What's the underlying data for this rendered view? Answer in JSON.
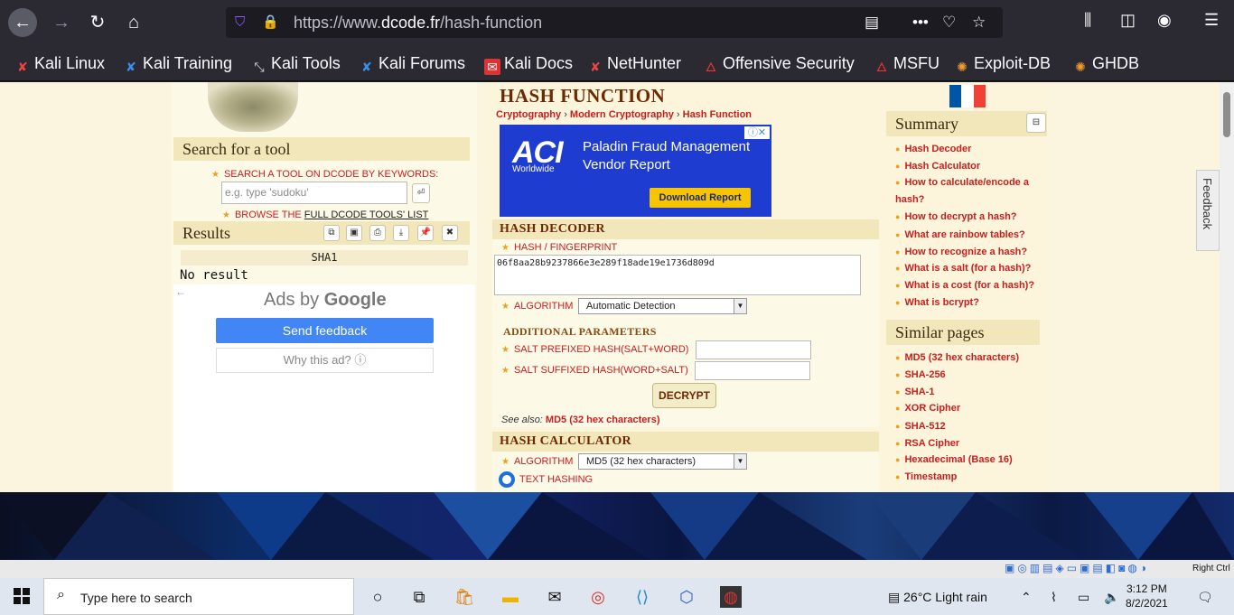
{
  "browser": {
    "url_prefix": "https://www.",
    "url_domain": "dcode.fr",
    "url_path": "/hash-function",
    "icons": [
      "back-icon",
      "forward-icon",
      "reload-icon",
      "home-icon",
      "tracking-shield-icon",
      "lock-icon",
      "reader-view-icon",
      "page-actions-icon",
      "pocket-icon",
      "bookmark-star-icon",
      "library-icon",
      "sidebar-icon",
      "account-icon",
      "menu-icon"
    ]
  },
  "bookmarks": [
    {
      "label": "Kali Linux"
    },
    {
      "label": "Kali Training"
    },
    {
      "label": "Kali Tools"
    },
    {
      "label": "Kali Forums"
    },
    {
      "label": "Kali Docs"
    },
    {
      "label": "NetHunter"
    },
    {
      "label": "Offensive Security"
    },
    {
      "label": "MSFU"
    },
    {
      "label": "Exploit-DB"
    },
    {
      "label": "GHDB"
    }
  ],
  "left": {
    "search_head": "Search for a tool",
    "search_hint": "SEARCH A TOOL ON DCODE BY KEYWORDS:",
    "search_placeholder": "e.g. type 'sudoku'",
    "browse_prefix": "BROWSE THE ",
    "browse_link": "FULL DCODE TOOLS' LIST",
    "results_head": "Results",
    "sha_label": "SHA1",
    "no_result": "No result",
    "ads_by": "Ads by ",
    "ads_google": "Google",
    "send_feedback": "Send feedback",
    "why_ad": "Why this ad? ⓘ"
  },
  "main": {
    "title": "HASH FUNCTION",
    "crumbs": [
      "Cryptography",
      "Modern Cryptography",
      "Hash Function"
    ],
    "ad": {
      "logo": "ACI",
      "logo_sub": "Worldwide",
      "line1": "Paladin Fraud Management",
      "line2": "Vendor Report",
      "cta": "Download Report"
    },
    "decoder_head": "HASH DECODER",
    "fingerprint_label": "HASH / FINGERPRINT",
    "hash_value": "06f8aa28b9237866e3e289f18ade19e1736d809d",
    "algorithm_label": "ALGORITHM",
    "algorithm_value": "Automatic Detection",
    "additional_head": "ADDITIONAL PARAMETERS",
    "salt_prefix_label": "SALT PREFIXED HASH(SALT+WORD)",
    "salt_suffix_label": "SALT SUFFIXED HASH(WORD+SALT)",
    "decrypt_label": "DECRYPT",
    "see_also_prefix": "See also: ",
    "see_also_link": "MD5 (32 hex characters)",
    "calculator_head": "HASH CALCULATOR",
    "calc_algorithm_label": "ALGORITHM",
    "calc_algorithm_value": "MD5 (32 hex characters)",
    "text_hashing_label": "TEXT HASHING"
  },
  "right": {
    "summary_head": "Summary",
    "summary_links": [
      "Hash Decoder",
      "Hash Calculator",
      "How to calculate/encode a",
      "hash?",
      "How to decrypt a hash?",
      "What are rainbow tables?",
      "How to recognize a hash?",
      "What is a salt (for a hash)?",
      "What is a cost (for a hash)?",
      "What is bcrypt?"
    ],
    "similar_head": "Similar pages",
    "similar_links": [
      "MD5 (32 hex characters)",
      "SHA-256",
      "SHA-1",
      "XOR Cipher",
      "SHA-512",
      "RSA Cipher",
      "Hexadecimal (Base 16)",
      "Timestamp"
    ],
    "feedback_tab": "Feedback",
    "flag_colors": [
      "#0055a4",
      "#ffffff",
      "#ef4135"
    ]
  },
  "vm": {
    "host_key": "Right Ctrl"
  },
  "taskbar": {
    "search_placeholder": "Type here to search",
    "weather": "26°C  Light rain",
    "time": "3:12 PM",
    "date": "8/2/2021"
  }
}
